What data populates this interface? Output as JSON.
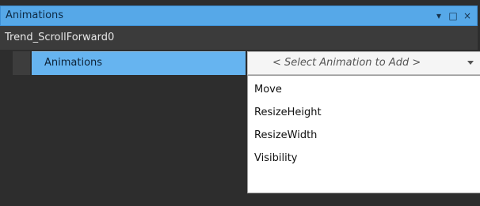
{
  "panel": {
    "title": "Animations",
    "controls": {
      "dropdown_glyph": "▾",
      "restore_glyph": "□",
      "close_glyph": "×"
    },
    "subheader": "Trend_ScrollForward0"
  },
  "property": {
    "label": "Animations",
    "select_placeholder": "< Select Animation to Add >"
  },
  "dropdown": {
    "items": [
      {
        "label": "Move"
      },
      {
        "label": "ResizeHeight"
      },
      {
        "label": "ResizeWidth"
      },
      {
        "label": "Visibility"
      }
    ]
  }
}
